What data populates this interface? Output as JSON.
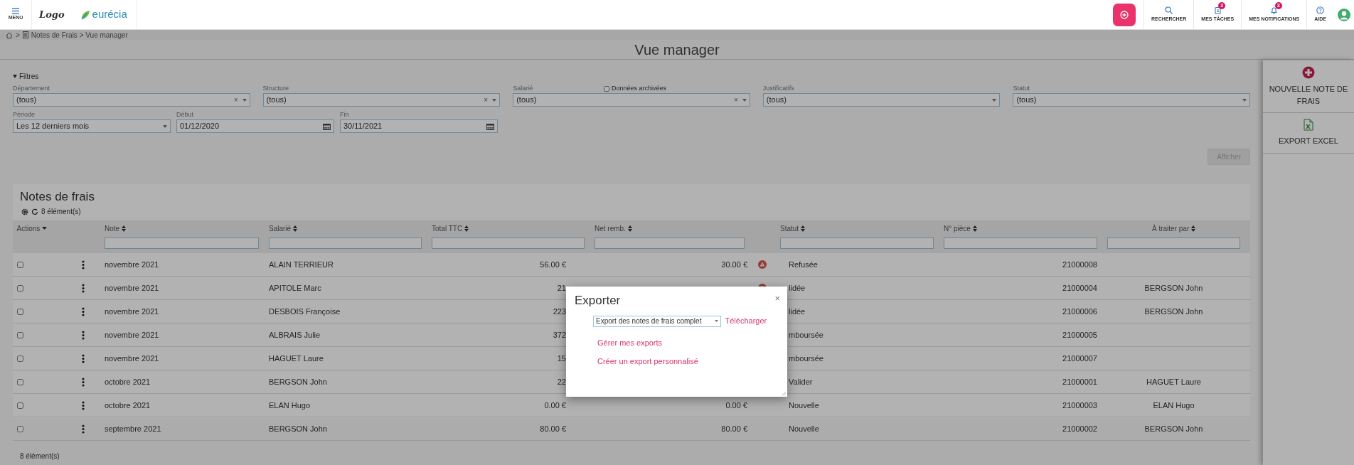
{
  "header": {
    "menu_label": "MENU",
    "logo_text": "Logo",
    "brand": "eurécia",
    "actions": [
      {
        "label": "RECHERCHER"
      },
      {
        "label": "MES TÂCHES",
        "badge": "3"
      },
      {
        "label": "MES NOTIFICATIONS",
        "badge": "3"
      },
      {
        "label": "AIDE"
      }
    ]
  },
  "breadcrumb": {
    "separator": ">",
    "trail": "Notes de Frais > Vue manager"
  },
  "page_title": "Vue manager",
  "filters": {
    "toggle": "Filtres",
    "expanded": true,
    "fields": [
      {
        "label": "Département",
        "value": "(tous)",
        "kind": "select",
        "clear": "×"
      },
      {
        "label": "Structure",
        "value": "(tous)",
        "kind": "select",
        "clear": "×"
      },
      {
        "label": "Salarié",
        "value": "(tous)",
        "kind": "select",
        "clear": "×"
      },
      {
        "label": "Justificatifs",
        "value": "(tous)",
        "kind": "select"
      },
      {
        "label": "Statut",
        "value": "(tous)",
        "kind": "select"
      }
    ],
    "archived": {
      "label": "Données archivées",
      "checked": false
    },
    "period_fields": [
      {
        "label": "Période",
        "value": "Les 12 derniers mois",
        "kind": "select"
      },
      {
        "label": "Début",
        "value": "01/12/2020",
        "kind": "date"
      },
      {
        "label": "Fin",
        "value": "30/11/2021",
        "kind": "date"
      }
    ]
  },
  "apply_button": {
    "label": "Afficher",
    "disabled": true
  },
  "side_actions": [
    {
      "label": "NOUVELLE NOTE DE FRAIS"
    },
    {
      "label": "EXPORT EXCEL"
    }
  ],
  "table": {
    "title": "Notes de frais",
    "count": "8 élément(s)",
    "columns": [
      {
        "label": "Actions",
        "kind": "menu"
      },
      {
        "kind": "kebab"
      },
      {
        "label": "Note",
        "kind": "sort"
      },
      {
        "label": "Salarié",
        "kind": "sort"
      },
      {
        "label": "Total TTC",
        "kind": "sort"
      },
      {
        "label": "Net remb.",
        "kind": "sort"
      },
      {
        "kind": "warning"
      },
      {
        "label": "Statut",
        "kind": "sort"
      },
      {
        "label": "N° pièce",
        "kind": "sort"
      },
      {
        "label": "À traiter par",
        "kind": "sort"
      }
    ],
    "rows": [
      {
        "selected": false,
        "note": "novembre 2021",
        "employee": "ALAIN TERRIEUR",
        "total": "56.00 €",
        "net": "30.00 €",
        "warning": true,
        "status": "Refusée",
        "piece": "21000008"
      },
      {
        "selected": false,
        "note": "novembre 2021",
        "employee": "APITOLE Marc",
        "total": "21",
        "warning": true,
        "status": "lidée",
        "piece": "21000004",
        "handler": "BERGSON John"
      },
      {
        "selected": false,
        "note": "novembre 2021",
        "employee": "DESBOIS Françoise",
        "total": "223",
        "status": "lidée",
        "piece": "21000006",
        "handler": "BERGSON John"
      },
      {
        "selected": false,
        "note": "novembre 2021",
        "employee": "ALBRAIS Julie",
        "total": "372",
        "status": "mboursée",
        "piece": "21000005"
      },
      {
        "selected": false,
        "note": "novembre 2021",
        "employee": "HAGUET Laure",
        "total": "15",
        "status": "mboursée",
        "piece": "21000007"
      },
      {
        "selected": false,
        "note": "octobre 2021",
        "employee": "BERGSON John",
        "total": "22",
        "status": "Valider",
        "piece": "21000001",
        "handler": "HAGUET Laure"
      },
      {
        "selected": false,
        "note": "octobre 2021",
        "employee": "ELAN Hugo",
        "total": "0.00 €",
        "net": "0.00 €",
        "warning": false,
        "status": "Nouvelle",
        "piece": "21000003",
        "handler": "ELAN Hugo"
      },
      {
        "selected": false,
        "note": "septembre 2021",
        "employee": "BERGSON John",
        "total": "80.00 €",
        "net": "80.00 €",
        "warning": false,
        "status": "Nouvelle",
        "piece": "21000002",
        "handler": "BERGSON John"
      }
    ],
    "footer": "8 élément(s)"
  },
  "dialog": {
    "title": "Exporter",
    "close": "×",
    "select_value": "Export des notes de frais complet",
    "download": "Télécharger",
    "links": [
      "Gérer mes exports",
      "Créer un export personnalisé"
    ]
  }
}
